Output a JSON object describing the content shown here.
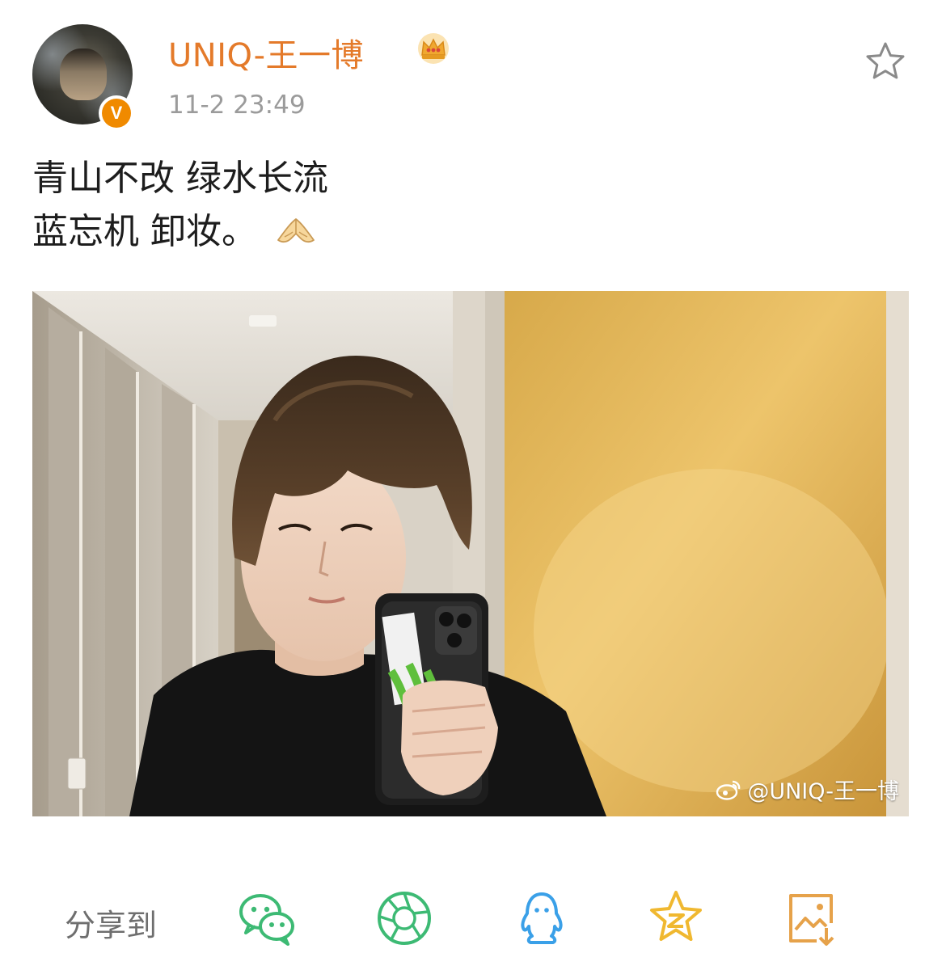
{
  "post": {
    "author": "UNIQ-王一博",
    "verified_badge": "V",
    "timestamp": "11-2 23:49",
    "text_lines": [
      "青山不改 绿水长流",
      "蓝忘机 卸妆。"
    ]
  },
  "photo": {
    "watermark": "@UNIQ-王一博"
  },
  "share": {
    "label": "分享到",
    "targets": [
      "wechat-icon",
      "moments-icon",
      "qq-icon",
      "qzone-icon",
      "save-image-icon"
    ]
  },
  "colors": {
    "username": "#e47a2a",
    "crown": "#f0a830",
    "share_icon": "#3dba74",
    "qq_icon": "#3aa0e8",
    "qzone_icon": "#f0b830",
    "save_icon": "#e6a24a"
  }
}
